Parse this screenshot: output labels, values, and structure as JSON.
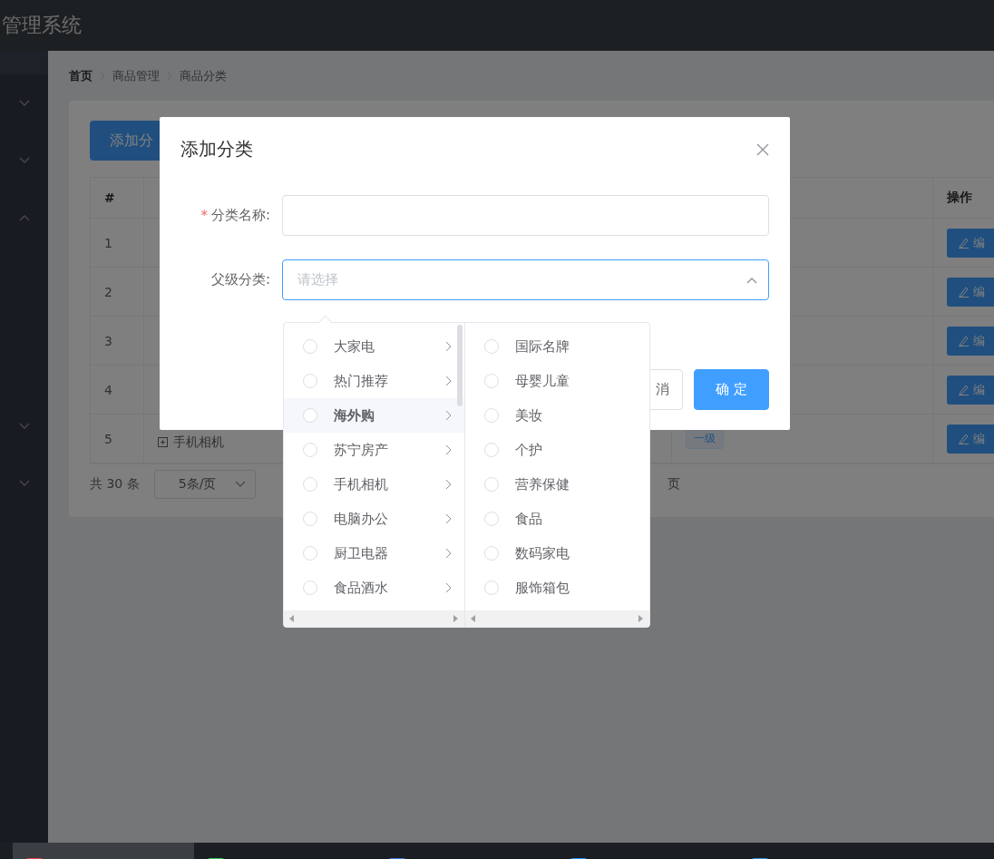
{
  "header": {
    "title": "管理系统"
  },
  "sidebar": {
    "menus": [
      {
        "expanded": false
      },
      {
        "expanded": false
      },
      {
        "expanded": true
      },
      {
        "expanded": false
      },
      {
        "expanded": false
      }
    ]
  },
  "breadcrumb": [
    "首页",
    "商品管理",
    "商品分类"
  ],
  "add_button": "添加分",
  "table": {
    "index_header": "#",
    "actions_header": "操作",
    "rows": [
      {
        "index": "1",
        "action": "编"
      },
      {
        "index": "2",
        "action": "编"
      },
      {
        "index": "3",
        "action": "编"
      },
      {
        "index": "4",
        "action": "编"
      },
      {
        "index": "5",
        "name": "手机相机",
        "level": "一级",
        "action": "编"
      }
    ]
  },
  "pagination": {
    "total": "共 30 条",
    "page_size": "5条/页",
    "suffix": "页"
  },
  "dialog": {
    "title": "添加分类",
    "fields": [
      {
        "kind": "input",
        "label": "分类名称:",
        "required_mark": "*"
      },
      {
        "kind": "select",
        "label": "父级分类:",
        "placeholder": "请选择",
        "open": true
      }
    ],
    "buttons": [
      {
        "kind": "default",
        "label": "消"
      },
      {
        "kind": "primary",
        "label": "确 定"
      }
    ]
  },
  "cascader": {
    "panels": [
      {
        "items": [
          {
            "label": "大家电",
            "checked": false,
            "selected": false,
            "has_children": true
          },
          {
            "label": "热门推荐",
            "checked": false,
            "selected": false,
            "has_children": true
          },
          {
            "label": "海外购",
            "checked": false,
            "selected": true,
            "has_children": true
          },
          {
            "label": "苏宁房产",
            "checked": false,
            "selected": false,
            "has_children": true
          },
          {
            "label": "手机相机",
            "checked": false,
            "selected": false,
            "has_children": true
          },
          {
            "label": "电脑办公",
            "checked": false,
            "selected": false,
            "has_children": true
          },
          {
            "label": "厨卫电器",
            "checked": false,
            "selected": false,
            "has_children": true
          },
          {
            "label": "食品酒水",
            "checked": false,
            "selected": false,
            "has_children": true
          }
        ]
      },
      {
        "items": [
          {
            "label": "国际名牌",
            "checked": false,
            "selected": false,
            "has_children": false
          },
          {
            "label": "母婴儿童",
            "checked": false,
            "selected": false,
            "has_children": false
          },
          {
            "label": "美妆",
            "checked": false,
            "selected": false,
            "has_children": false
          },
          {
            "label": "个护",
            "checked": false,
            "selected": false,
            "has_children": false
          },
          {
            "label": "营养保健",
            "checked": false,
            "selected": false,
            "has_children": false
          },
          {
            "label": "食品",
            "checked": false,
            "selected": false,
            "has_children": false
          },
          {
            "label": "数码家电",
            "checked": false,
            "selected": false,
            "has_children": false
          },
          {
            "label": "服饰箱包",
            "checked": false,
            "selected": false,
            "has_children": false
          }
        ]
      }
    ]
  },
  "taskbar": {
    "apps": [
      {
        "selected": true,
        "color": "#e04848"
      },
      {
        "selected": false,
        "color": "#2fc95a"
      },
      {
        "selected": false,
        "color": "#3c78d8"
      },
      {
        "selected": false,
        "color": "#1e90ff"
      },
      {
        "selected": false,
        "color": "#2a8fe0"
      }
    ]
  }
}
